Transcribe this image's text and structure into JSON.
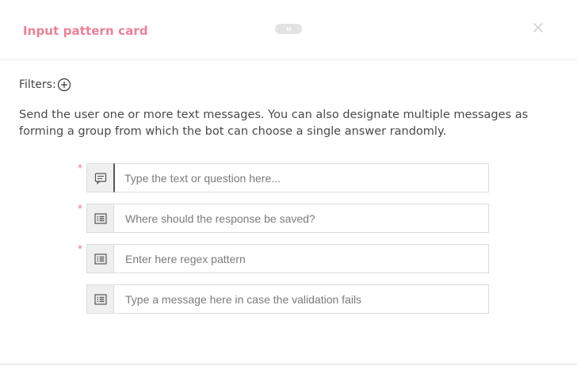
{
  "header": {
    "title": "Input pattern card",
    "close_icon": "close-icon",
    "handle_icon": "drag-handle-icon"
  },
  "filters": {
    "label": "Filters:",
    "add_icon": "plus-circle-icon"
  },
  "description": "Send the user one or more text messages. You can also designate multiple messages as forming a group from which the bot can choose a single answer randomly.",
  "fields": [
    {
      "required": true,
      "icon": "message-icon",
      "placeholder": "Type the text or question here...",
      "value": ""
    },
    {
      "required": true,
      "icon": "list-icon",
      "placeholder": "Where should the response be saved?",
      "value": ""
    },
    {
      "required": true,
      "icon": "list-icon",
      "placeholder": "Enter here regex pattern",
      "value": ""
    },
    {
      "required": false,
      "icon": "list-icon",
      "placeholder": "Type a message here in case the validation fails",
      "value": ""
    }
  ],
  "required_marker": "*",
  "colors": {
    "title": "#ee7f96",
    "required": "#f06f8a",
    "icon_box": "#efefef",
    "border": "#dddddd"
  }
}
